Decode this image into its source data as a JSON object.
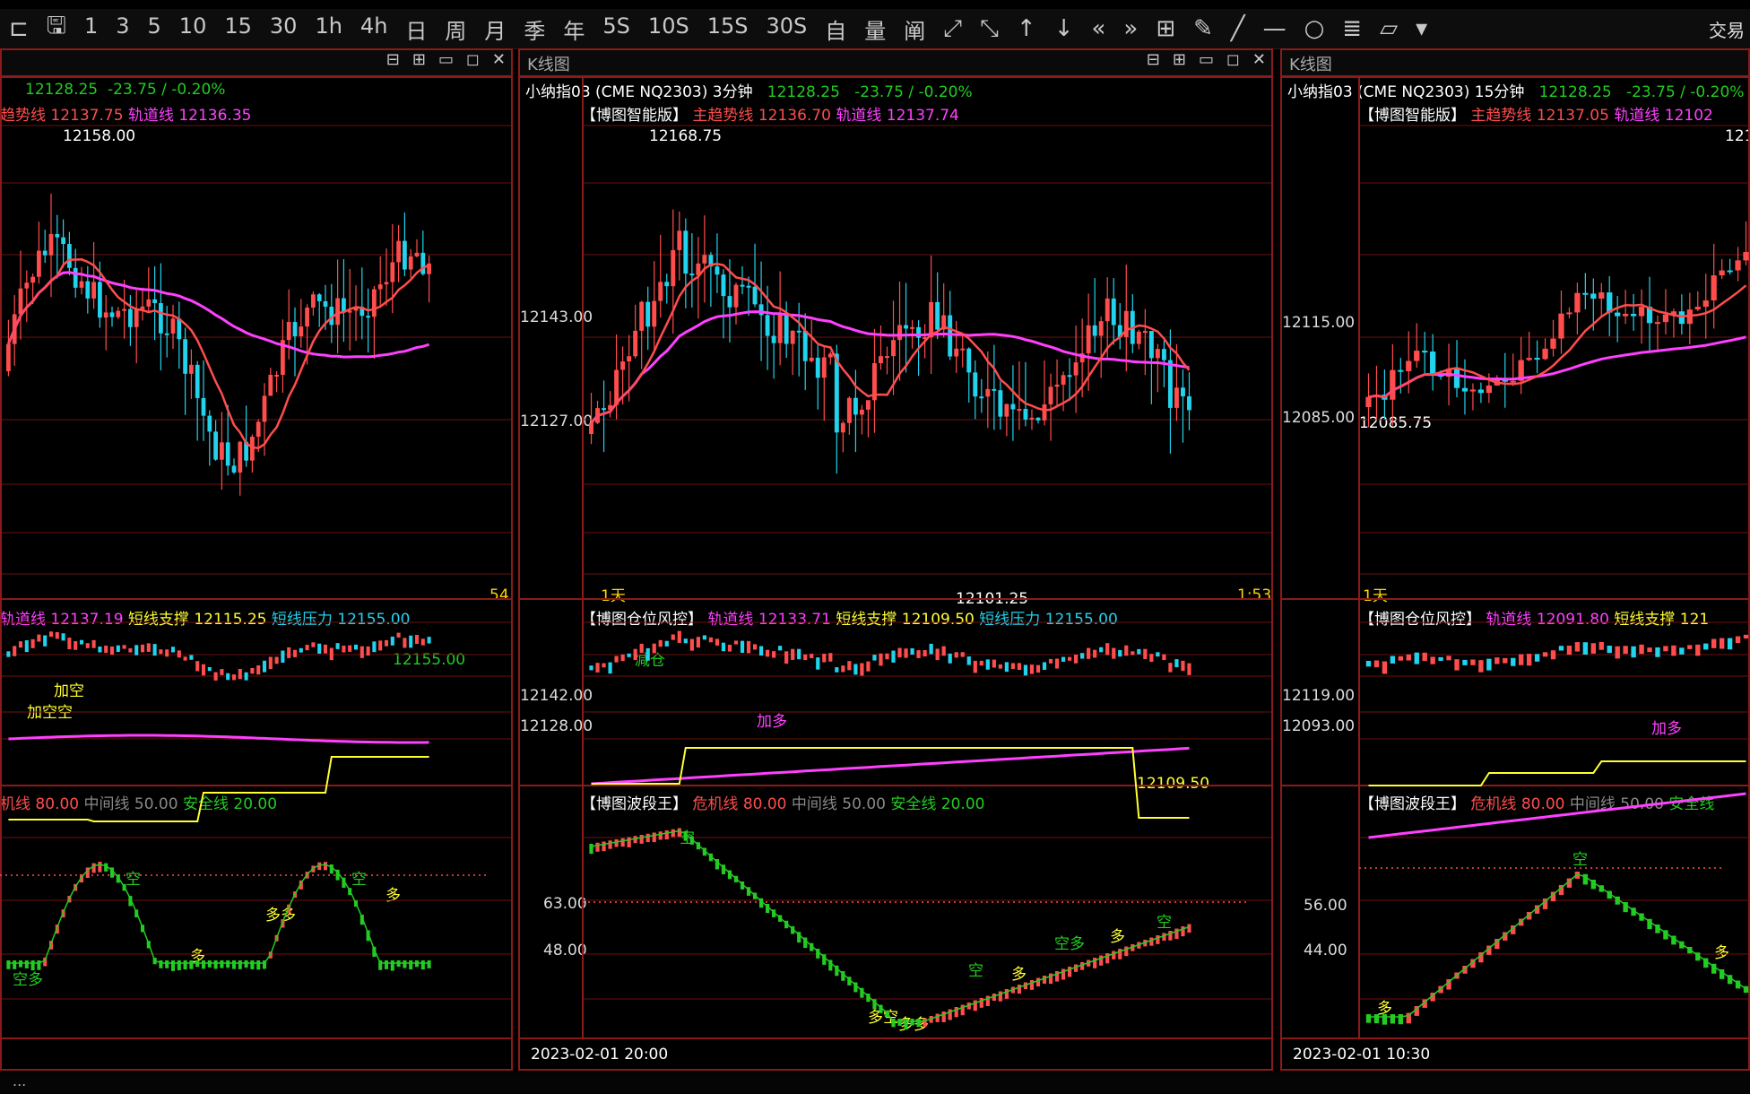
{
  "toolbar": {
    "items": [
      "1",
      "3",
      "5",
      "10",
      "15",
      "30",
      "1h",
      "4h",
      "日",
      "周",
      "月",
      "季",
      "年",
      "5S",
      "10S",
      "15S",
      "30S",
      "自",
      "量",
      "阐"
    ],
    "icons": [
      "expand-icon",
      "compress-icon",
      "arrow-up-icon",
      "arrow-down-icon",
      "double-left-icon",
      "double-right-icon",
      "grid-icon",
      "pencil-icon",
      "line-icon",
      "hline-icon",
      "circle-icon",
      "fib-icon",
      "channel-icon",
      "dropdown-icon"
    ],
    "right_label": "交易"
  },
  "colors": {
    "up": "#ff4d4d",
    "down": "#22d3ee",
    "grid": "#6b1010",
    "magenta": "#ff40ff",
    "yellow": "#ffff33",
    "green": "#22cc22",
    "blue": "#2020ff"
  },
  "panes": [
    {
      "title": "",
      "info": {
        "price": "12128.25",
        "change": "-23.75 / -0.20%"
      },
      "main_header": {
        "a_label": "趋势线",
        "a_val": "12137.75",
        "b_label": "轨道线",
        "b_val": "12136.35"
      },
      "main_high_label": "12158.00",
      "main_right_label": "54",
      "risk_header": {
        "a_label": "轨道线",
        "a_val": "12137.19",
        "b_label": "短线支撑",
        "b_val": "12115.25",
        "c_label": "短线压力",
        "c_val": "12155.00"
      },
      "risk_annot": "12155.00",
      "risk_marks": [
        "加空",
        "加空空"
      ],
      "wave_header": {
        "a_label": "机线",
        "a_val": "80.00",
        "b_label": "中间线",
        "b_val": "50.00",
        "c_label": "安全线",
        "c_val": "20.00"
      },
      "wave_marks": [
        "空",
        "空多",
        "多",
        "多多",
        "空",
        "多"
      ]
    },
    {
      "title": "K线图",
      "symbol": "小纳指03 (CME NQ2303) 3分钟",
      "info": {
        "price": "12128.25",
        "change": "-23.75 / -0.20%"
      },
      "main_header": {
        "name": "【博图智能版】",
        "a_label": "主趋势线",
        "a_val": "12136.70",
        "b_label": "轨道线",
        "b_val": "12137.74"
      },
      "main_high_label": "12168.75",
      "main_low_label": "12101.25",
      "main_period": "1天",
      "main_right_label": "1:53",
      "main_y": [
        "12143.00",
        "12127.00"
      ],
      "risk_header": {
        "name": "【博图仓位风控】",
        "a_label": "轨道线",
        "a_val": "12133.71",
        "b_label": "短线支撑",
        "b_val": "12109.50",
        "c_label": "短线压力",
        "c_val": "12155.00"
      },
      "risk_y": [
        "12142.00",
        "12128.00"
      ],
      "risk_annot": "12109.50",
      "risk_marks": [
        "减仓",
        "加多"
      ],
      "wave_header": {
        "name": "【博图波段王】",
        "a_label": "危机线",
        "a_val": "80.00",
        "b_label": "中间线",
        "b_val": "50.00",
        "c_label": "安全线",
        "c_val": "20.00"
      },
      "wave_y": [
        "63.00",
        "48.00"
      ],
      "wave_marks": [
        "空",
        "多空",
        "多多",
        "空",
        "多",
        "空多",
        "多",
        "空"
      ],
      "date_label": "2023-02-01 20:00"
    },
    {
      "title": "K线图",
      "symbol": "小纳指03 (CME NQ2303) 15分钟",
      "info": {
        "price": "12128.25",
        "change": "-23.75 / -0.20%"
      },
      "main_header": {
        "name": "【博图智能版】",
        "a_label": "主趋势线",
        "a_val": "12137.05",
        "b_label": "轨道线",
        "b_val": "12102"
      },
      "main_high_label": "121",
      "main_low_label": "12085.75",
      "main_period": "1天",
      "main_y": [
        "12115.00",
        "12085.00"
      ],
      "risk_header": {
        "name": "【博图仓位风控】",
        "a_label": "轨道线",
        "a_val": "12091.80",
        "b_label": "短线支撑",
        "b_val": "121"
      },
      "risk_y": [
        "12119.00",
        "12093.00"
      ],
      "risk_marks": [
        "加多"
      ],
      "wave_header": {
        "name": "【博图波段王】",
        "a_label": "危机线",
        "a_val": "80.00",
        "b_label": "中间线",
        "b_val": "50.00",
        "c_label": "安全线"
      },
      "wave_y": [
        "56.00",
        "44.00"
      ],
      "wave_marks": [
        "空",
        "多",
        "多"
      ],
      "date_label": "2023-02-01 10:30"
    }
  ],
  "status": {
    "text": "..."
  }
}
